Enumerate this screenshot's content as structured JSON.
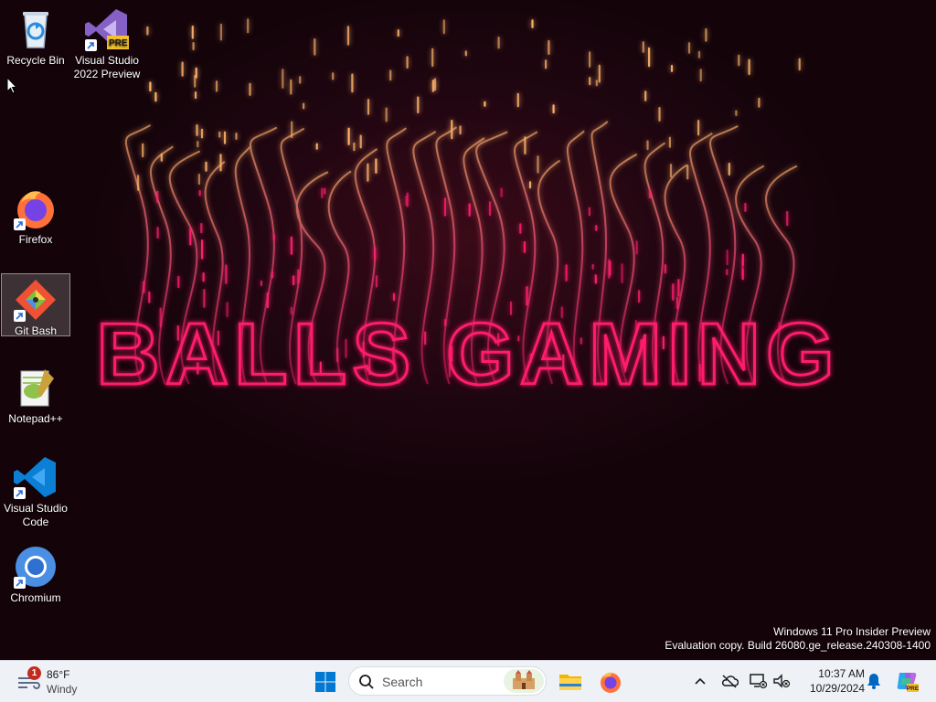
{
  "desktop": {
    "icons": [
      {
        "name": "recycle-bin",
        "label": "Recycle Bin"
      },
      {
        "name": "visual-studio-2022-preview",
        "label": "Visual Studio 2022 Preview",
        "badge": "PRE"
      },
      {
        "name": "firefox",
        "label": "Firefox"
      },
      {
        "name": "git-bash",
        "label": "Git Bash"
      },
      {
        "name": "notepad-plus-plus",
        "label": "Notepad++"
      },
      {
        "name": "visual-studio-code",
        "label": "Visual Studio Code"
      },
      {
        "name": "chromium",
        "label": "Chromium"
      }
    ]
  },
  "wallpaper": {
    "text": "BALLS GAMING",
    "glow_color": "#ff1f6b",
    "spark_color": "#ffb36b"
  },
  "watermark": {
    "line1": "Windows 11 Pro Insider Preview",
    "line2": "Evaluation copy. Build 26080.ge_release.240308-1400"
  },
  "taskbar": {
    "weather": {
      "temp": "86°F",
      "condition": "Windy",
      "badge": "1"
    },
    "search_placeholder": "Search",
    "pinned": [
      "start",
      "search",
      "file-explorer",
      "firefox"
    ],
    "tray": {
      "time": "10:37 AM",
      "date": "10/29/2024"
    }
  },
  "colors": {
    "taskbar_bg": "#eef1f6",
    "accent": "#0067c0",
    "notification_badge": "#c42b1c"
  }
}
